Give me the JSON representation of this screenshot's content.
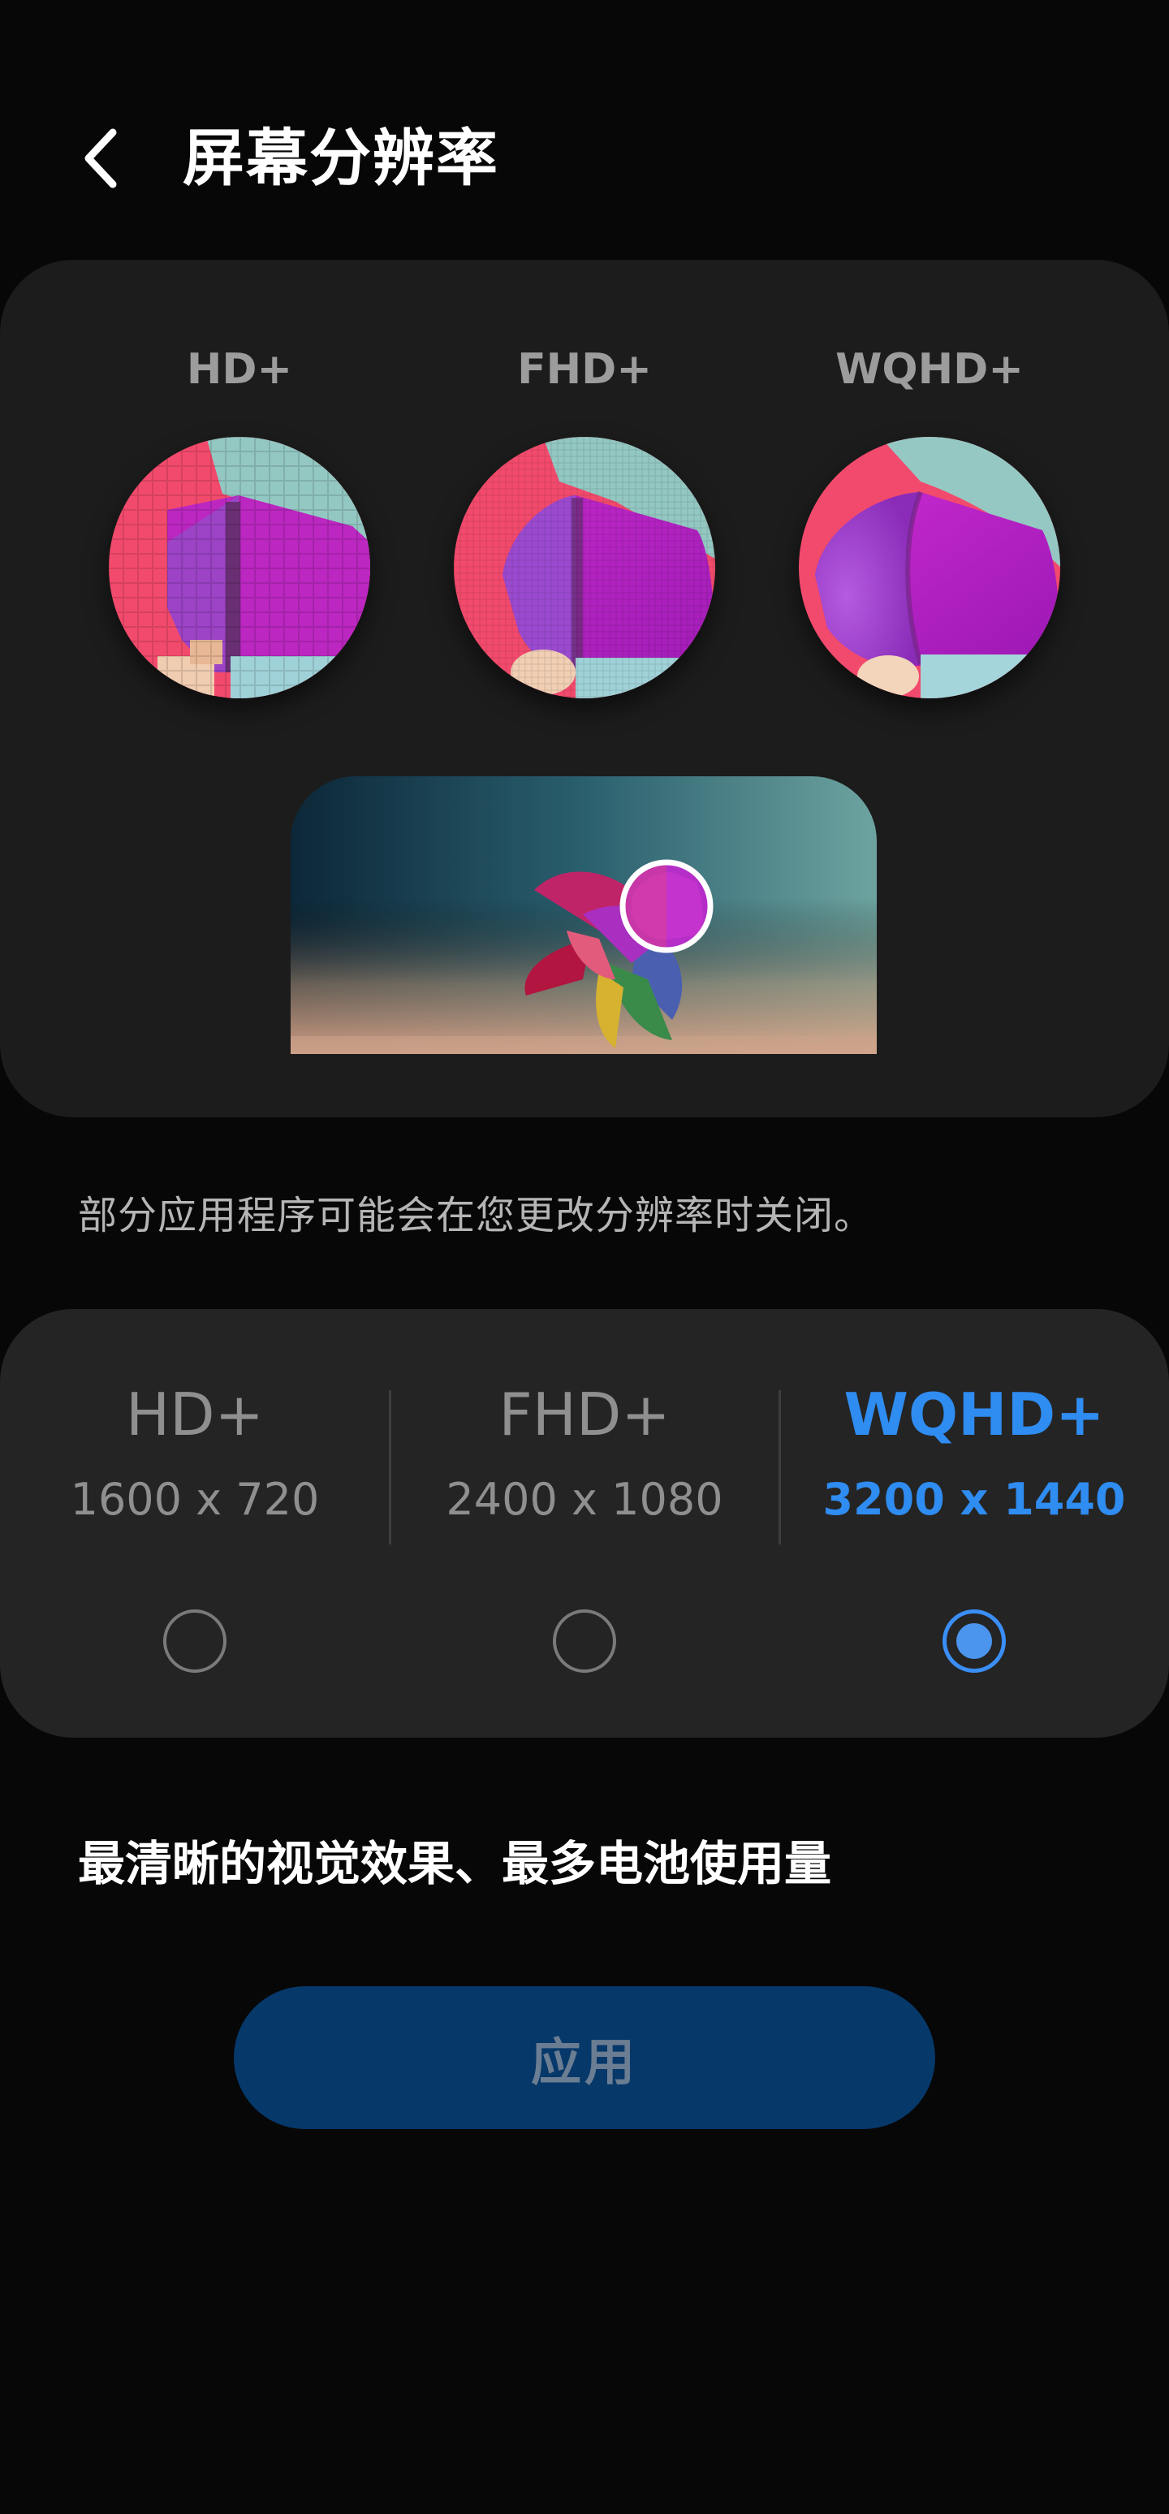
{
  "header": {
    "title": "屏幕分辨率",
    "back_icon": "chevron-left-icon"
  },
  "preview": {
    "labels": [
      "HD+",
      "FHD+",
      "WQHD+"
    ]
  },
  "note": "部分应用程序可能会在您更改分辨率时关闭。",
  "options": [
    {
      "name": "HD+",
      "resolution": "1600 x 720",
      "selected": false
    },
    {
      "name": "FHD+",
      "resolution": "2400 x 1080",
      "selected": false
    },
    {
      "name": "WQHD+",
      "resolution": "3200 x 1440",
      "selected": true
    }
  ],
  "description": "最清晰的视觉效果、最多电池使用量",
  "apply_label": "应用",
  "colors": {
    "accent": "#2f8cf0",
    "apply_bg": "#06386a",
    "card_bg": "#1c1c1c",
    "options_bg": "#242424"
  }
}
